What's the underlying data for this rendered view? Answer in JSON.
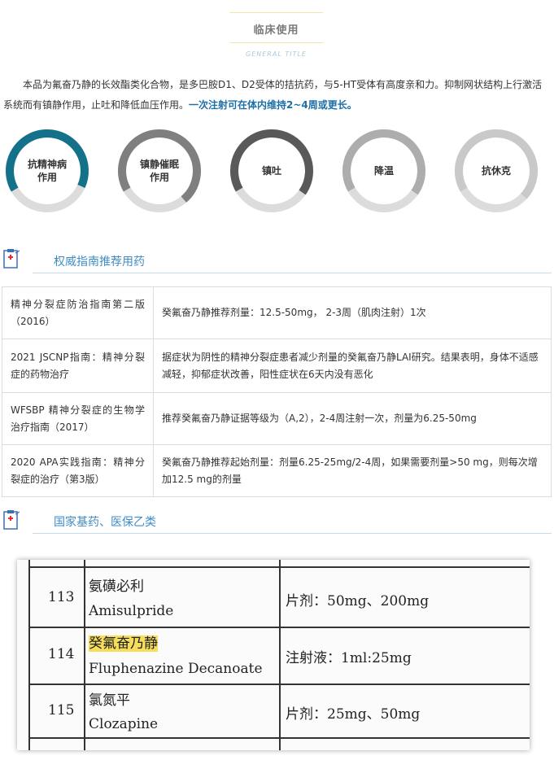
{
  "header": {
    "title": "临床使用",
    "subtitle": "GENERAL TITLE"
  },
  "intro": {
    "text": "　　本品为氟奋乃静的长效酯类化合物，是多巴胺D1、D2受体的拮抗药，与5-HT受体有高度亲和力。抑制网状结构上行激活系统而有镇静作用，止吐和降低血压作用。",
    "highlight": "一次注射可在体内维持2~4周或更长。"
  },
  "effects": [
    {
      "line1": "抗精神病",
      "line2": "作用",
      "color": "#14718a",
      "fraction": 0.65
    },
    {
      "line1": "镇静催眠",
      "line2": "作用",
      "color": "#7f7f7f",
      "fraction": 0.72
    },
    {
      "line1": "镇吐",
      "line2": "",
      "color": "#595959",
      "fraction": 0.68
    },
    {
      "line1": "降温",
      "line2": "",
      "color": "#adadad",
      "fraction": 0.68
    },
    {
      "line1": "抗休克",
      "line2": "",
      "color": "#c9c9c9",
      "fraction": 0.7
    }
  ],
  "section1": {
    "title": "权威指南推荐用药"
  },
  "guidelines": [
    {
      "guide": "精神分裂症防治指南第二版（2016）",
      "rec": "癸氟奋乃静推荐剂量：12.5-50mg， 2-3周（肌肉注射）1次"
    },
    {
      "guide": "2021 JSCNP指南：精神分裂症的药物治疗",
      "rec": "据症状为阴性的精神分裂症患者减少剂量的癸氟奋乃静LAI研究。结果表明，身体不适感减轻，抑郁症状改善，阳性症状在6天内没有恶化"
    },
    {
      "guide": "WFSBP 精神分裂症的生物学治疗指南（2017）",
      "rec": "推荐癸氟奋乃静证据等级为（A,2），2-4周注射一次，剂量为6.25-50mg"
    },
    {
      "guide": "2020 APA实践指南：精神分裂症的治疗（第3版）",
      "rec": "癸氟奋乃静推荐起始剂量：剂量6.25-25mg/2-4周，如果需要剂量>50 mg，则每次增加12.5 mg的剂量"
    }
  ],
  "section2": {
    "title": "国家基药、医保乙类"
  },
  "drug_list": [
    {
      "no": "113",
      "cn": "氨磺必利",
      "en": "Amisulpride",
      "spec": "片剂：50mg、200mg"
    },
    {
      "no": "114",
      "cn": "癸氟奋乃静",
      "en": "Fluphenazine Decanoate",
      "spec": "注射液：1ml:25mg"
    },
    {
      "no": "115",
      "cn": "氯氮平",
      "en": "Clozapine",
      "spec": "片剂：25mg、50mg"
    }
  ]
}
